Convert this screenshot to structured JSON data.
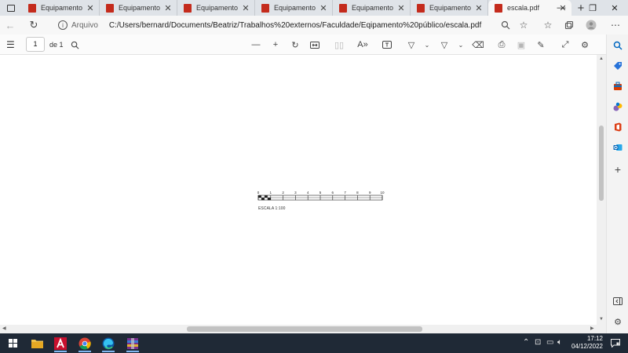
{
  "browser": {
    "tabs": [
      {
        "title": "Equipamento P",
        "active": false
      },
      {
        "title": "Equipamento P",
        "active": false
      },
      {
        "title": "Equipamento P",
        "active": false
      },
      {
        "title": "Equipamento P",
        "active": false
      },
      {
        "title": "Equipamento P",
        "active": false
      },
      {
        "title": "Equipamento P",
        "active": false
      },
      {
        "title": "escala.pdf",
        "active": true
      }
    ],
    "close_glyph": "✕",
    "new_tab_glyph": "+",
    "window_controls": {
      "minimize": "—",
      "restore": "❐",
      "close": "✕"
    },
    "address": {
      "label": "Arquivo",
      "url": "C:/Users/bernard/Documents/Beatriz/Trabalhos%20externos/Faculdade/Eqipamento%20público/escala.pdf"
    }
  },
  "pdf_toolbar": {
    "page_number": "1",
    "page_count": "de 1"
  },
  "document": {
    "scale_bar": {
      "ticks": [
        "0",
        "1",
        "2",
        "3",
        "4",
        "5",
        "6",
        "7",
        "8",
        "9",
        "10"
      ],
      "caption": "ESCALA 1:100"
    }
  },
  "taskbar": {
    "time": "17:12",
    "date": "04/12/2022"
  },
  "colors": {
    "pdf_icon": "#c42b1c",
    "taskbar": "#1f2936",
    "accent": "#0067c0"
  }
}
